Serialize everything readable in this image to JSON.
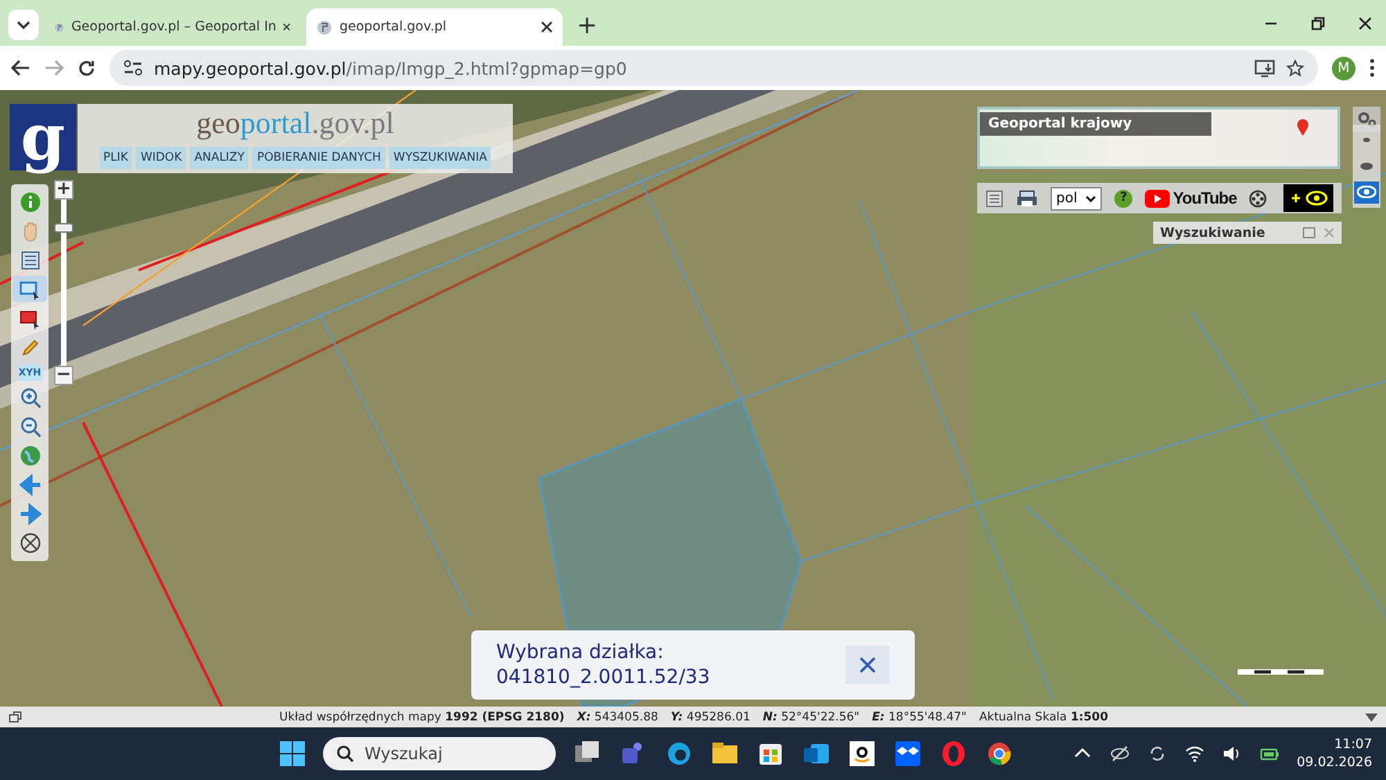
{
  "browser": {
    "tabs": [
      {
        "title": "Geoportal.gov.pl – Geoportal In",
        "selected": false
      },
      {
        "title": "geoportal.gov.pl",
        "selected": true
      }
    ],
    "new_tab": "+",
    "url_host": "mapy.geoportal.gov.pl",
    "url_path": "/imap/Imgp_2.html?gpmap=gp0",
    "profile": "M"
  },
  "map": {
    "logo": "g",
    "title_parts": [
      "g",
      "eo",
      "portal",
      ".gov.pl"
    ],
    "menu": [
      "PLIK",
      "WIDOK",
      "ANALIZY",
      "POBIERANIE DANYCH",
      "WYSZUKIWANIA"
    ],
    "tools": [
      {
        "kind": "info",
        "selected": false
      },
      {
        "kind": "hand",
        "selected": false
      },
      {
        "kind": "table",
        "selected": false
      },
      {
        "kind": "select",
        "selected": true
      },
      {
        "kind": "select-red",
        "selected": false
      },
      {
        "kind": "pencil",
        "selected": false
      },
      {
        "kind": "label",
        "label": "XYH",
        "selected": false
      },
      {
        "kind": "zoom-in",
        "selected": false
      },
      {
        "kind": "zoom-out",
        "selected": false
      },
      {
        "kind": "globe",
        "selected": false
      },
      {
        "kind": "back",
        "selected": false
      },
      {
        "kind": "forward",
        "selected": false
      },
      {
        "kind": "crosshair",
        "selected": false
      }
    ],
    "zoom": {
      "plus": "+",
      "minus": "−",
      "level": 0.85
    },
    "minimap_label": "Geoportal krajowy",
    "language": "pol",
    "help": "?",
    "youtube": "YouTube",
    "view_modes": [
      {
        "kind": "dot",
        "selected": false
      },
      {
        "kind": "eye-small",
        "selected": false
      },
      {
        "kind": "eye",
        "selected": true
      }
    ],
    "search_panel": "Wyszukiwanie",
    "popup": {
      "title": "Wybrana działka:",
      "parcel": "041810_2.0011.52/33"
    }
  },
  "status_bar": {
    "crs": "Układ współrzędnych mapy **1992 (EPSG 2180)**",
    "x": "**X:** 543405.88",
    "y": "**Y:** 495286.01",
    "n": "**N:** 52°45'22.56\"",
    "e": "**E:** 18°55'48.47\"",
    "scale": "Aktualna Skala **1:500**"
  },
  "taskbar": {
    "search_placeholder": "Wyszukaj",
    "time": "11:07",
    "date": "09.02.2026"
  }
}
